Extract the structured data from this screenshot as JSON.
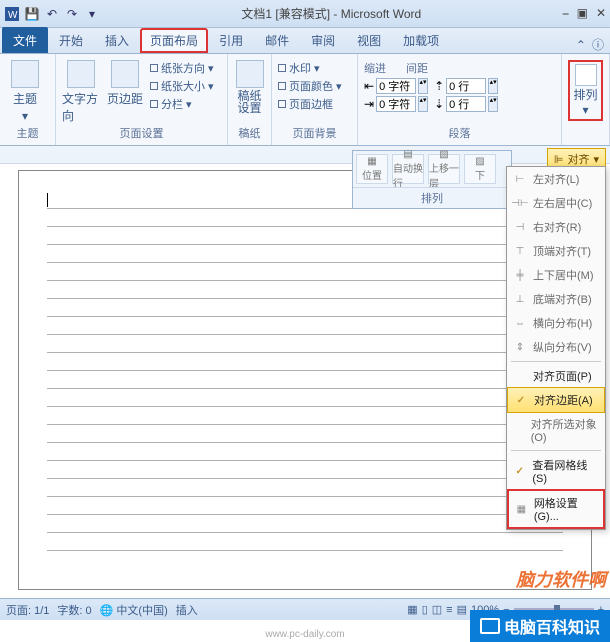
{
  "title": "文档1 [兼容模式] - Microsoft Word",
  "qat": {
    "save": "保存",
    "undo": "撤销",
    "redo": "重做"
  },
  "tabs": {
    "file": "文件",
    "items": [
      "开始",
      "插入",
      "页面布局",
      "引用",
      "邮件",
      "审阅",
      "视图",
      "加载项"
    ]
  },
  "ribbon": {
    "theme": {
      "label": "主题",
      "btn": "主题"
    },
    "pagesetup": {
      "label": "页面设置",
      "text_dir": "文字方向",
      "margins": "页边距",
      "orientation": "纸张方向",
      "size": "纸张大小",
      "columns": "分栏"
    },
    "manuscript": {
      "label": "稿纸",
      "btn": "稿纸\n设置"
    },
    "pagebg": {
      "label": "页面背景",
      "watermark": "水印",
      "color": "页面颜色",
      "border": "页面边框"
    },
    "paragraph": {
      "label": "段落",
      "indent": "缩进",
      "spacing": "间距",
      "left_val": "0 字符",
      "right_val": "0 字符",
      "before_val": "0 行",
      "after_val": "0 行"
    },
    "arrange": {
      "label": "排列",
      "btn": "排列"
    }
  },
  "float": {
    "position": "位置",
    "wrap": "自动换行",
    "front": "上移一层",
    "back": "下",
    "label": "排列"
  },
  "align_header": "对齐",
  "dropdown": {
    "left": "左对齐(L)",
    "center_h": "左右居中(C)",
    "right": "右对齐(R)",
    "top": "顶端对齐(T)",
    "center_v": "上下居中(M)",
    "bottom": "底端对齐(B)",
    "dist_h": "横向分布(H)",
    "dist_v": "纵向分布(V)",
    "to_page": "对齐页面(P)",
    "to_margin": "对齐边距(A)",
    "to_selected": "对齐所选对象(O)",
    "view_grid": "查看网格线(S)",
    "grid_settings": "网格设置(G)..."
  },
  "status": {
    "page": "页面: 1/1",
    "words": "字数: 0",
    "lang": "中文(中国)",
    "mode": "插入",
    "zoom": "100%"
  },
  "watermark_text": "脑力软件啊",
  "brand": "电脑百科知识",
  "footer_url": "www.pc-daily.com"
}
